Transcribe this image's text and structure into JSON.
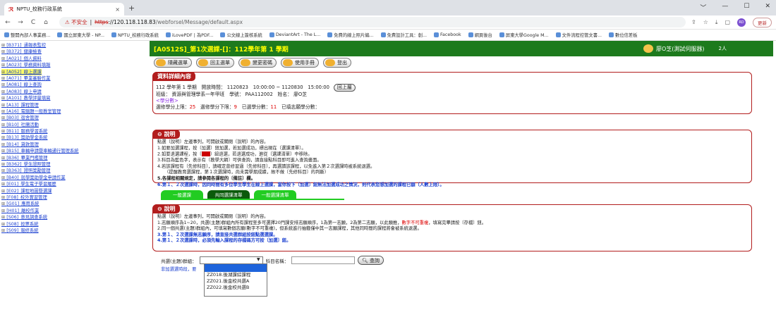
{
  "browser": {
    "tab_title": "NPTU_校務行政系統",
    "tab_close": "×",
    "new_tab": "+",
    "window_controls": [
      "﹀",
      "—",
      "☐",
      "✕"
    ],
    "nav": [
      "←",
      "→",
      "C",
      "⌂"
    ],
    "insecure_label": "⚠ 不安全",
    "url_scheme": "https",
    "url_host": "://120.118.118.83",
    "url_path": "/webforsel/Message/default.aspx",
    "right_icons": [
      "⇪",
      "☆",
      "⤓",
      "▢"
    ],
    "avatar": "RD",
    "update_label": "更新",
    "bookmarks": [
      "整開內部人事業務...",
      "國立屏東大學 - NP...",
      "NPTU_校務行政系統",
      "iLovePDF | 為PDF...",
      "公文線上簽核系統",
      "DeviantArt - The L...",
      "免費的線上照片編...",
      "免費設計工具：創...",
      "Facebook",
      "網頁後台",
      "屏東大學Google M...",
      "文件流程控管文書...",
      "數位信差板"
    ]
  },
  "sidebar": {
    "items": [
      {
        "label": "[B371]_通報表監控",
        "active": false
      },
      {
        "label": "[B372]_健康檢查",
        "active": false
      },
      {
        "label": "[A021]_個人資料",
        "active": false
      },
      {
        "label": "[A023]_學務資料填報",
        "active": false
      },
      {
        "label": "[A052]_線上選課",
        "active": true
      },
      {
        "label": "[A071]_畢業審驗作業",
        "active": false
      },
      {
        "label": "[A081]_線上查詢",
        "active": false
      },
      {
        "label": "[A083]_線上申請",
        "active": false
      },
      {
        "label": "[A101]_教學評量填寫",
        "active": false
      },
      {
        "label": "[A13]_課程管理",
        "active": false
      },
      {
        "label": "[A16]_電腦題一般教室管理",
        "active": false
      },
      {
        "label": "[B03]_宿舍管理",
        "active": false
      },
      {
        "label": "[B10]_社團活動",
        "active": false
      },
      {
        "label": "[B11]_服務學習系統",
        "active": false
      },
      {
        "label": "[B13]_獎助學金系統",
        "active": false
      },
      {
        "label": "[B14]_貸款管理",
        "active": false
      },
      {
        "label": "[B15]_車輛申請暨車輛通行管理系統",
        "active": false
      },
      {
        "label": "[B36]_畢業門檻管理",
        "active": false
      },
      {
        "label": "[B362]_學生證照管理",
        "active": false
      },
      {
        "label": "[B363]_證照獎勵管理",
        "active": false
      },
      {
        "label": "[B40]_就學獎助學金申請作業",
        "active": false
      },
      {
        "label": "[E01]_學生電子學習履歷",
        "active": false
      },
      {
        "label": "[E02]_課程地圖暨選課",
        "active": false
      },
      {
        "label": "[F08]_校外實習管理",
        "active": false
      },
      {
        "label": "[G01]_應用系統",
        "active": false
      },
      {
        "label": "[H01]_離校作業",
        "active": false
      },
      {
        "label": "[S06]_意見調查系統",
        "active": false
      },
      {
        "label": "[S08]_投票系統",
        "active": false
      },
      {
        "label": "[S09]_報修系統",
        "active": false
      }
    ]
  },
  "header": {
    "title": "[A0512S]_第1次選課-[]：112學年第 1 學期",
    "user": "廖O芝(測試伺服器)",
    "count": "2人"
  },
  "toolbar": {
    "hide_menu": "隱藏選單",
    "main_menu": "回主選單",
    "change_pw": "變更密碼",
    "manual": "使用手冊",
    "logout": "登出"
  },
  "detail": {
    "title": "資料詳細內容",
    "line1": "112 學年第 1 學期　開放時間： 1120823　10:00:00 ~ 1120830　15:00:00",
    "back": "回上層",
    "line2": "班級： 資源與管理學系一年甲班　學號： PAA112002　姓名： 廖O芝",
    "credit_link": "<學分數>",
    "credit_line_a": "選修學分上限：",
    "credit_max": "25",
    "credit_line_b": "　選修學分下限：",
    "credit_min": "9",
    "credit_line_c": "　已選學分數：",
    "credit_sel": "11",
    "credit_line_d": "　已填志願學分數："
  },
  "desc1": {
    "title": "說明",
    "l0": "點選〔說明〕左邊事列，可開啟或關閉〔說明〕的內容。",
    "l1": "1.如要加選課程，按〔加選〕鈕加選，若加選成功，標出現在〔選課清單〕。",
    "l2a": "2.如要退選課程，按〔",
    "l2b": "〕鈕退選，若退選成功，進從〔選課清單〕中移除。",
    "l3": "3.科目為藍色字，表示有〔教學大綱〕可供查詢，請直接點科目即可進入查詢畫面。",
    "l4": "4.若該課程有〔先修科目〕，請確定曾修習過〔先修科目〕，再選讀該課程，以免進入第２次選課時被系統退選。",
    "l4b": "（提醒教育選課程，第１次選課時，尚未需學期成績，故不做〔先修科目〕的判斷）",
    "l5": "5.各課程相關規定，請參閱各課程的〔備註〕欄。",
    "l6": "6.第１、２次選課時，因同時間有多位學生學生在線上選課，當你按下〔加選〕鈕無法加選成功之情況，則代表您想加選的課程已額〔人數上限〕。"
  },
  "tabs": [
    "一般選課",
    "共同選課清單",
    "一般選課清單"
  ],
  "desc2": {
    "title": "說明",
    "l0": "點選〔說明〕左邊事列，可開啟或關閉〔說明〕的內容。",
    "l1a": "1.志願順序為1~20，共選(主題)群組內所有課程至多可選擇20門課安排志願順序，1為第一志願，2為第二志願，以此類推，",
    "l1b": "數字不可重複",
    "l1c": "，填寫完畢請按〔存檔〕鈕。",
    "l2": "2.同一個共選(主題)群組內，可填寫數個志願(數字不可重複)，但系統進行抽籤僅中其一志願課程，其他同時間的課程將會被系統退選。",
    "l3": "3.第１、２次選課無志願序，請直接共選群組按鈕點選選課。",
    "l4": "4.第１、２次選課時，必須先輸入課程的存檔碼方可按〔加選〕鈕。"
  },
  "search": {
    "group_label": "共選(主題)群組：",
    "group_value": "",
    "subject_label": "科目名稱：",
    "subject_value": "",
    "query": "查詢",
    "note": "非加選選時段，要"
  },
  "dropdown": {
    "options": [
      "",
      "ZZ018.後湖課綜課程",
      "ZZ021.後金校共選A",
      "ZZ022.後金校共選B"
    ]
  }
}
